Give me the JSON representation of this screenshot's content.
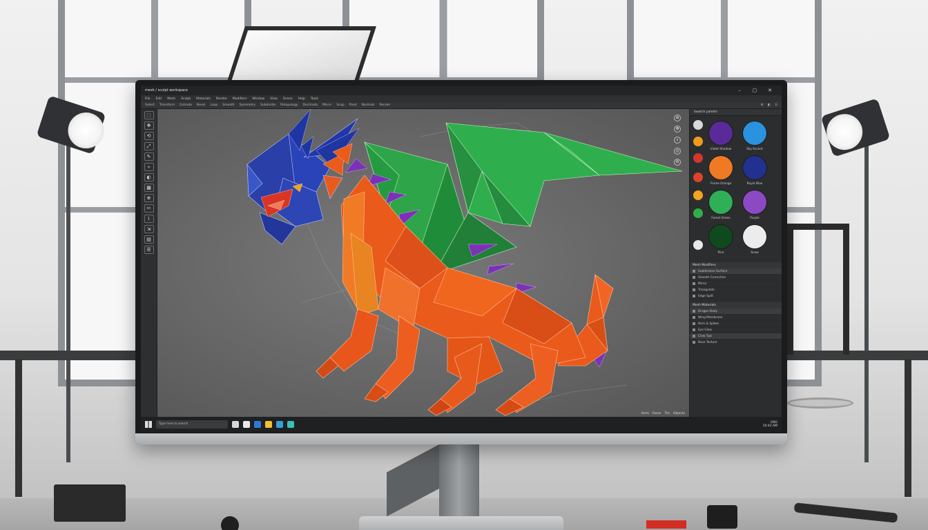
{
  "app": {
    "title": "mesh / sculpt workspace",
    "window_controls": [
      "–",
      "▢",
      "✕"
    ]
  },
  "menubar": [
    "File",
    "Edit",
    "Mesh",
    "Sculpt",
    "Materials",
    "Render",
    "Modifiers",
    "Window",
    "View",
    "Scene",
    "Help",
    "Tools"
  ],
  "toolbar": {
    "items": [
      "Select",
      "Transform",
      "Extrude",
      "Bevel",
      "Loop",
      "Smooth",
      "Symmetry",
      "Subdivide",
      "Retopology",
      "Decimate",
      "Mirror",
      "Snap",
      "Pivot",
      "Normals",
      "Render"
    ],
    "right": [
      "⚙",
      "◧",
      "☰"
    ]
  },
  "left_tools": [
    "⬚",
    "✥",
    "⟲",
    "⤢",
    "✎",
    "⌁",
    "◐",
    "▦",
    "⊕",
    "✂",
    "⌇",
    "⇲",
    "▤",
    "☰"
  ],
  "viewport": {
    "nav_icons": [
      "⊕",
      "✥",
      "⌕",
      "◎",
      "⚙"
    ],
    "status": [
      "Verts",
      "Faces",
      "Tris",
      "Objects"
    ]
  },
  "swatches": {
    "header": "Swatch palette",
    "mini_colors": [
      "#d9d9d9",
      "#f29a1c",
      "#d3362b",
      "#e0422d",
      "#f2a51b",
      "#2fae49",
      "#e8e8e8"
    ],
    "big": [
      {
        "color": "#5b2a9a",
        "label": "Violet Shadow"
      },
      {
        "color": "#2a92df",
        "label": "Sky Accent"
      },
      {
        "color": "#f07a24",
        "label": "Flame Orange"
      },
      {
        "color": "#22318f",
        "label": "Royal Blue"
      },
      {
        "color": "#2fb057",
        "label": "Forest Green"
      },
      {
        "color": "#8b49c4",
        "label": "Purple"
      },
      {
        "color": "#0e4a1e",
        "label": "Pine"
      },
      {
        "color": "#ececec",
        "label": "Snow"
      }
    ]
  },
  "sections": [
    {
      "title": "Mesh Modifiers",
      "rows": [
        "Subdivision Surface",
        "Smooth Corrective",
        "Mirror",
        "Triangulate",
        "Edge Split"
      ]
    },
    {
      "title": "Mesh Materials",
      "rows": [
        "Dragon Body",
        "Wing Membrane",
        "Horn & Spikes",
        "Eye Glow",
        "Claw Tips",
        "Base Texture"
      ]
    }
  ],
  "taskbar": {
    "search_placeholder": "Type here to search",
    "icon_colors": [
      "#d8d8d8",
      "#e9e9e9",
      "#2f78d6",
      "#f2c12e",
      "#3a9ed8",
      "#3cc0b9"
    ],
    "tray": [
      "ENG",
      "10:42 AM"
    ]
  }
}
